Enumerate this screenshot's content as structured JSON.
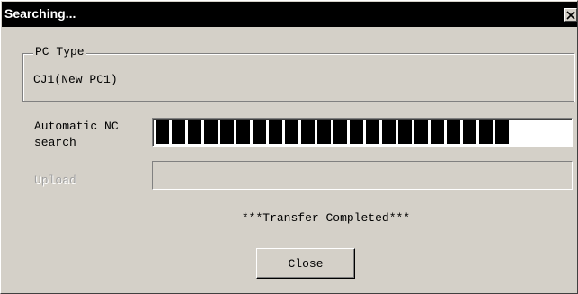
{
  "window": {
    "title": "Searching...",
    "close_icon": "close-icon"
  },
  "pc_type": {
    "legend": "PC Type",
    "value": "CJ1(New PC1)"
  },
  "auto_search": {
    "label_line1": "Automatic NC",
    "label_line2": "search",
    "progress_segments": 22,
    "progress_fraction": 1.0
  },
  "upload": {
    "label": "Upload",
    "progress_fraction": 0.0
  },
  "status_text": "***Transfer Completed***",
  "buttons": {
    "close_label": "Close"
  },
  "colors": {
    "dialog_bg": "#d4d0c8",
    "titlebar_bg": "#000000",
    "progress_fill": "#000000",
    "disabled_text": "#a0a0a0"
  }
}
